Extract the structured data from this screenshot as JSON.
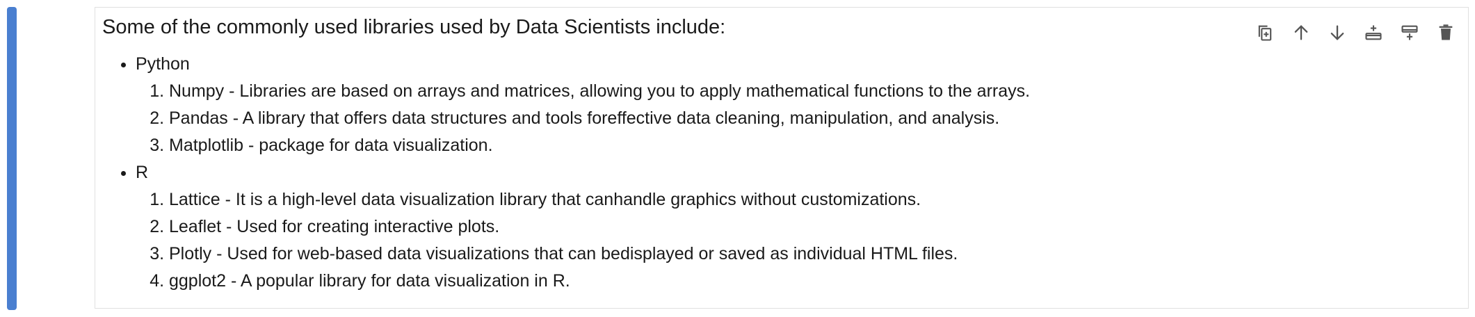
{
  "cell": {
    "heading": "Some of the commonly used libraries used by Data Scientists include:",
    "groups": [
      {
        "label": "Python",
        "items": [
          "Numpy - Libraries are based on arrays and matrices, allowing you to apply mathematical functions to the arrays.",
          "Pandas - A library that offers data structures and tools foreffective data cleaning, manipulation, and analysis.",
          "Matplotlib - package for data visualization."
        ]
      },
      {
        "label": "R",
        "items": [
          "Lattice - It is a high-level data visualization library that canhandle graphics without customizations.",
          "Leaflet - Used for creating interactive plots.",
          "Plotly - Used for web-based data visualizations that can bedisplayed or saved as individual HTML files.",
          "ggplot2 - A popular library for data visualization in R."
        ]
      }
    ]
  },
  "toolbar": {
    "icons": [
      "duplicate-icon",
      "move-up-icon",
      "move-down-icon",
      "insert-above-icon",
      "insert-below-icon",
      "delete-icon"
    ]
  },
  "colors": {
    "active_bar": "#4a7fd0",
    "icon": "#555555",
    "cell_border": "#e0e0e0"
  }
}
